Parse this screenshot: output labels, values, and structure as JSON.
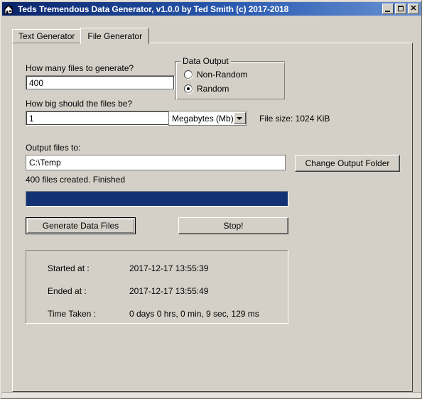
{
  "window": {
    "title": "Teds Tremendous Data Generator, v1.0.0 by Ted Smith (c) 2017-2018",
    "app_icon": "house-icon",
    "controls": {
      "minimize": "_",
      "maximize": "□",
      "close": "✕"
    }
  },
  "tabs": [
    {
      "label": "Text Generator",
      "active": false
    },
    {
      "label": "File Generator",
      "active": true
    }
  ],
  "form": {
    "count_label": "How many files to generate?",
    "count_value": "400",
    "size_label": "How big should the files be?",
    "size_value": "1",
    "unit_selected": "Megabytes (Mb)",
    "file_size_label": "File size:  1024 KiB",
    "output_label": "Output files to:",
    "output_value": "C:\\Temp",
    "change_folder_button": "Change Output Folder"
  },
  "data_output": {
    "group_title": "Data Output",
    "options": [
      {
        "label": "Non-Random",
        "selected": false
      },
      {
        "label": "Random",
        "selected": true
      }
    ]
  },
  "progress": {
    "status_text": "400 files created. Finished",
    "percent": 100,
    "fill_color": "#123274"
  },
  "actions": {
    "generate_button": "Generate Data Files",
    "stop_button": "Stop!"
  },
  "stats": {
    "rows": [
      {
        "label": "Started at :",
        "value": "2017-12-17 13:55:39"
      },
      {
        "label": "Ended at :",
        "value": "2017-12-17 13:55:49"
      },
      {
        "label": "Time Taken :",
        "value": "0 days 0 hrs, 0 min, 9 sec, 129 ms"
      }
    ]
  },
  "colors": {
    "face": "#d4d0c8",
    "titlebar_start": "#0a246a",
    "titlebar_end": "#6a92d4",
    "progress": "#123274"
  }
}
